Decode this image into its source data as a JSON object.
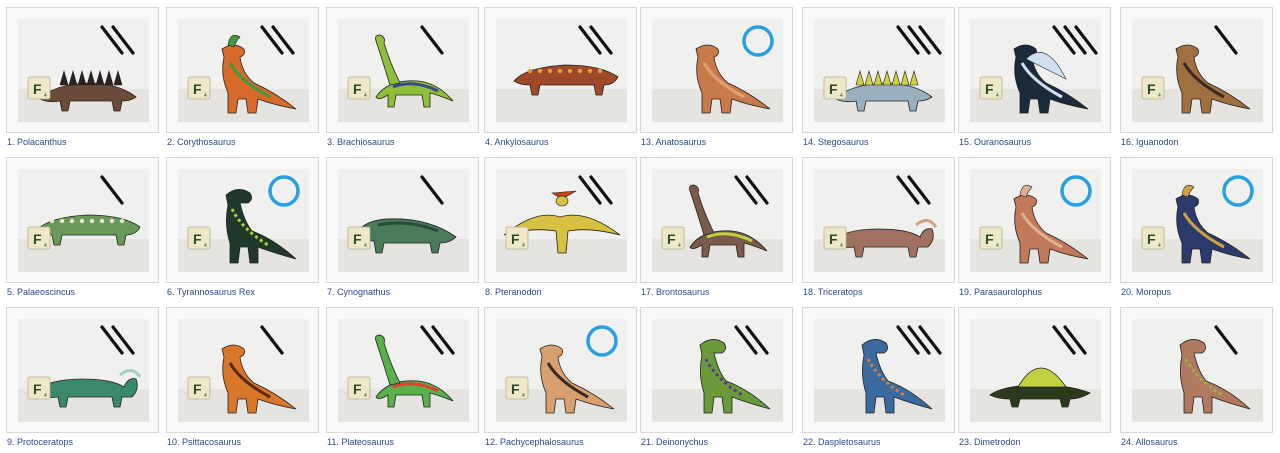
{
  "gallery": {
    "items": [
      {
        "caption": "1. Polacanthus",
        "body": "#6b4a3a",
        "accent": "#2a2220",
        "marks": "slash-2",
        "shape": "spiky-quadruped"
      },
      {
        "caption": "2. Corythosaurus",
        "body": "#d86a2a",
        "accent": "#3d9a3d",
        "marks": "slash-2",
        "shape": "biped-crest"
      },
      {
        "caption": "3. Brachiosaurus",
        "body": "#8fbf3a",
        "accent": "#3a4a8a",
        "marks": "slash-1",
        "shape": "long-neck"
      },
      {
        "caption": "4. Ankylosaurus",
        "body": "#a0482a",
        "accent": "#e0a040",
        "marks": "slash-2",
        "shape": "armored"
      },
      {
        "caption": "5. Palaeoscincus",
        "body": "#6a9a5a",
        "accent": "#e8e8d0",
        "marks": "slash-1",
        "shape": "armored"
      },
      {
        "caption": "6. Tyrannosaurus Rex",
        "body": "#1f3a2a",
        "accent": "#a8d040",
        "marks": "circle",
        "shape": "theropod"
      },
      {
        "caption": "7. Cynognathus",
        "body": "#4a7a5a",
        "accent": "#2a4a3a",
        "marks": "slash-1",
        "shape": "quadruped"
      },
      {
        "caption": "8. Pteranodon",
        "body": "#d8c040",
        "accent": "#c04020",
        "marks": "slash-2",
        "shape": "pterosaur"
      },
      {
        "caption": "9. Protoceratops",
        "body": "#3a8a6a",
        "accent": "#a0d0c0",
        "marks": "slash-2",
        "shape": "ceratopsian"
      },
      {
        "caption": "10. Psittacosaurus",
        "body": "#d8772a",
        "accent": "#5a2a10",
        "marks": "slash-1",
        "shape": "biped"
      },
      {
        "caption": "11. Plateosaurus",
        "body": "#5ab04a",
        "accent": "#e04030",
        "marks": "slash-2",
        "shape": "long-neck"
      },
      {
        "caption": "12. Pachycephalosaurus",
        "body": "#d8a070",
        "accent": "#3a2a20",
        "marks": "circle",
        "shape": "biped"
      },
      {
        "caption": "13. Anatosaurus",
        "body": "#c87a4a",
        "accent": "#e0a070",
        "marks": "circle",
        "shape": "biped"
      },
      {
        "caption": "14. Stegosaurus",
        "body": "#9ab0c0",
        "accent": "#d0d040",
        "marks": "slash-3",
        "shape": "stego"
      },
      {
        "caption": "15. Ouranosaurus",
        "body": "#1a2a3a",
        "accent": "#d0e0f0",
        "marks": "slash-3",
        "shape": "biped-sail"
      },
      {
        "caption": "16. Iguanodon",
        "body": "#a07040",
        "accent": "#3a2a20",
        "marks": "slash-1",
        "shape": "biped"
      },
      {
        "caption": "17. Brontosaurus",
        "body": "#7a5a4a",
        "accent": "#c0d040",
        "marks": "slash-2",
        "shape": "long-neck"
      },
      {
        "caption": "18. Triceratops",
        "body": "#a07060",
        "accent": "#d0a080",
        "marks": "slash-2",
        "shape": "ceratopsian"
      },
      {
        "caption": "19. Parasaurolophus",
        "body": "#c07a5a",
        "accent": "#e0b090",
        "marks": "circle",
        "shape": "biped-crest"
      },
      {
        "caption": "20. Moropus",
        "body": "#2a3a6a",
        "accent": "#d0a040",
        "marks": "circle",
        "shape": "biped-crest"
      },
      {
        "caption": "21. Deinonychus",
        "body": "#6a9a3a",
        "accent": "#5a3a8a",
        "marks": "slash-2",
        "shape": "theropod"
      },
      {
        "caption": "22. Daspletosaurus",
        "body": "#3a6aa0",
        "accent": "#d08040",
        "marks": "slash-3",
        "shape": "theropod"
      },
      {
        "caption": "23. Dimetrodon",
        "body": "#2a3a1a",
        "accent": "#c0d040",
        "marks": "slash-2",
        "shape": "sail-quadruped"
      },
      {
        "caption": "24. Allosaurus",
        "body": "#b07a60",
        "accent": "#a0b040",
        "marks": "slash-1",
        "shape": "theropod"
      }
    ]
  },
  "colors": {
    "caption_link": "#2a4a8c",
    "frame_border": "#d8d8d8",
    "mark_black": "#111111",
    "mark_circle": "#2aa0e0",
    "tile_face": "#ece8c8",
    "tile_text": "#2a4a2a"
  },
  "tile": {
    "letter": "F",
    "score": "4"
  }
}
